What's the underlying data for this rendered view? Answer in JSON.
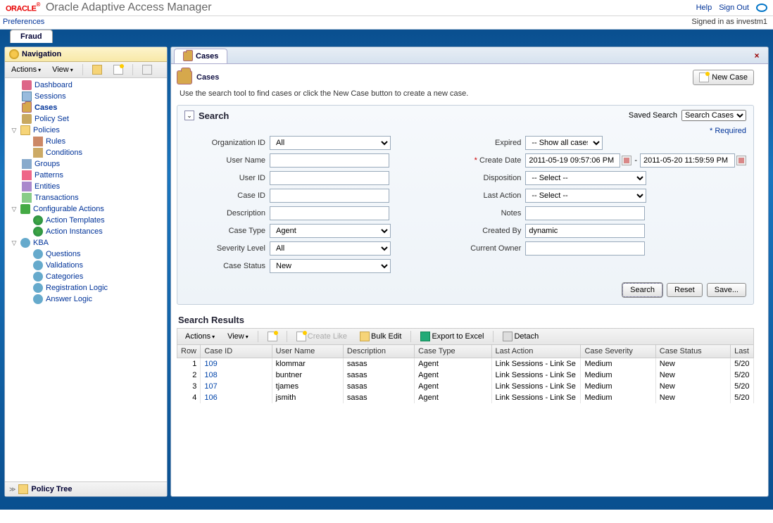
{
  "header": {
    "logo": "ORACLE",
    "app_title": "Oracle Adaptive Access Manager",
    "help": "Help",
    "sign_out": "Sign Out",
    "preferences": "Preferences",
    "signed_in": "Signed in as investm1"
  },
  "top_tab": "Fraud",
  "nav": {
    "title": "Navigation",
    "actions": "Actions",
    "view": "View",
    "items": {
      "dashboard": "Dashboard",
      "sessions": "Sessions",
      "cases": "Cases",
      "policy_set": "Policy Set",
      "policies": "Policies",
      "rules": "Rules",
      "conditions": "Conditions",
      "groups": "Groups",
      "patterns": "Patterns",
      "entities": "Entities",
      "transactions": "Transactions",
      "config_actions": "Configurable Actions",
      "action_templates": "Action Templates",
      "action_instances": "Action Instances",
      "kba": "KBA",
      "questions": "Questions",
      "validations": "Validations",
      "categories": "Categories",
      "reg_logic": "Registration Logic",
      "answer_logic": "Answer Logic"
    },
    "footer": "Policy Tree"
  },
  "content": {
    "tab": "Cases",
    "page_title": "Cases",
    "new_case": "New Case",
    "instruction": "Use the search tool to find cases or click the New Case button to create a new case.",
    "search": {
      "title": "Search",
      "saved_label": "Saved Search",
      "saved_value": "Search Cases",
      "required": "* Required",
      "fields": {
        "org_id": "Organization ID",
        "org_id_val": "All",
        "user_name": "User Name",
        "user_id": "User ID",
        "case_id": "Case ID",
        "description": "Description",
        "case_type": "Case Type",
        "case_type_val": "Agent",
        "severity": "Severity Level",
        "severity_val": "All",
        "case_status": "Case Status",
        "case_status_val": "New",
        "expired": "Expired",
        "expired_val": "-- Show all cases --",
        "create_date": "Create Date",
        "create_from": "2011-05-19 09:57:06 PM",
        "create_to": "2011-05-20 11:59:59 PM",
        "disposition": "Disposition",
        "disposition_val": "-- Select --",
        "last_action": "Last Action",
        "last_action_val": "-- Select --",
        "notes": "Notes",
        "created_by": "Created By",
        "created_by_val": "dynamic",
        "current_owner": "Current Owner"
      },
      "buttons": {
        "search": "Search",
        "reset": "Reset",
        "save": "Save..."
      }
    },
    "results": {
      "title": "Search Results",
      "toolbar": {
        "actions": "Actions",
        "view": "View",
        "create_like": "Create Like",
        "bulk_edit": "Bulk Edit",
        "export": "Export to Excel",
        "detach": "Detach"
      },
      "columns": {
        "row": "Row",
        "case_id": "Case ID",
        "user_name": "User Name",
        "description": "Description",
        "case_type": "Case Type",
        "last_action": "Last Action",
        "case_severity": "Case Severity",
        "case_status": "Case Status",
        "last": "Last"
      },
      "rows": [
        {
          "n": "1",
          "id": "109",
          "user": "klommar",
          "desc": "sasas",
          "type": "Agent",
          "action": "Link Sessions - Link Se",
          "sev": "Medium",
          "status": "New",
          "last": "5/20"
        },
        {
          "n": "2",
          "id": "108",
          "user": "buntner",
          "desc": "sasas",
          "type": "Agent",
          "action": "Link Sessions - Link Se",
          "sev": "Medium",
          "status": "New",
          "last": "5/20"
        },
        {
          "n": "3",
          "id": "107",
          "user": "tjames",
          "desc": "sasas",
          "type": "Agent",
          "action": "Link Sessions - Link Se",
          "sev": "Medium",
          "status": "New",
          "last": "5/20"
        },
        {
          "n": "4",
          "id": "106",
          "user": "jsmith",
          "desc": "sasas",
          "type": "Agent",
          "action": "Link Sessions - Link Se",
          "sev": "Medium",
          "status": "New",
          "last": "5/20"
        }
      ]
    }
  }
}
